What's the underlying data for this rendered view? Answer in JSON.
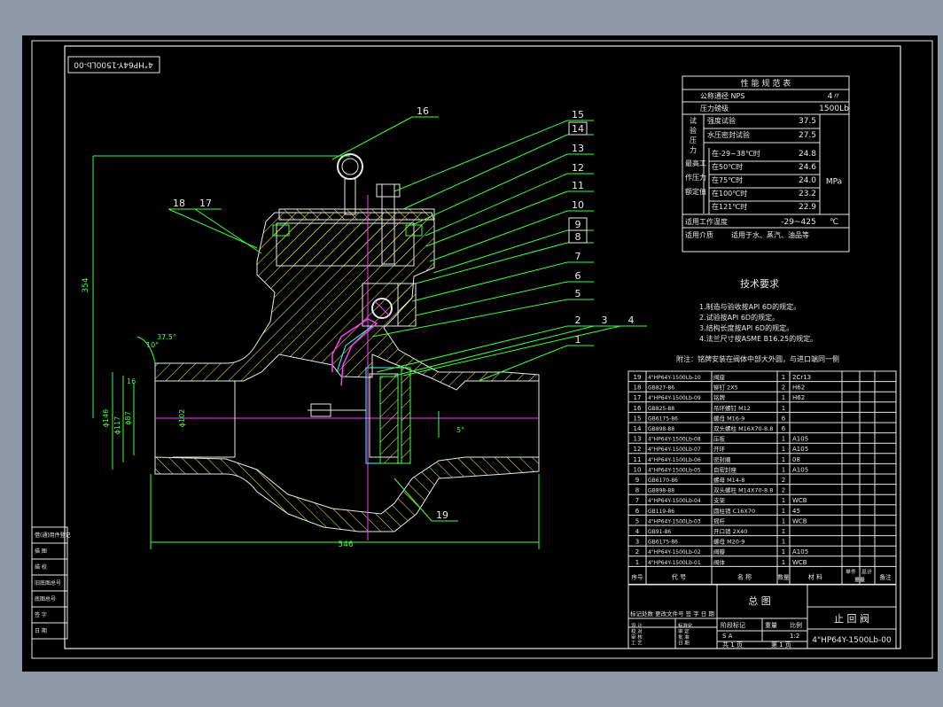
{
  "drawing_code_vertical": "4\"HP64Y-1500Lb-00",
  "part_numbers": [
    "16",
    "15",
    "14",
    "13",
    "12",
    "11",
    "10",
    "9",
    "8",
    "7",
    "6",
    "5",
    "2",
    "3",
    "4",
    "1",
    "18",
    "17",
    "19"
  ],
  "dimensions": {
    "overall_length": "546",
    "height": "354",
    "dia_146": "ϕ146",
    "dia_117": "ϕ117",
    "dia_87": "ϕ87",
    "dia_102": "ϕ102",
    "len_16": "16",
    "angle_10": "10°",
    "angle_37": "37.5°",
    "angle_5": "5°"
  },
  "perf_table": {
    "title": "性 能 规 范 表",
    "rows": [
      {
        "label": "公称通径    NPS",
        "value": "4〃"
      },
      {
        "label": "压力磅级",
        "value": "1500Lb"
      }
    ],
    "test_group": "试验压力",
    "test_rows": [
      {
        "label": "强度试验",
        "value": "37.5"
      },
      {
        "label": "水压密封试验",
        "value": "27.5"
      }
    ],
    "work_group_lines": [
      "最高工",
      "作压力",
      "额定值"
    ],
    "work_rows": [
      {
        "label": "在-29~38℃时",
        "value": "24.8"
      },
      {
        "label": "在50℃时",
        "value": "24.6"
      },
      {
        "label": "在75℃时",
        "value": "24.0"
      },
      {
        "label": "在100℃时",
        "value": "23.2"
      },
      {
        "label": "在121℃时",
        "value": "22.9"
      }
    ],
    "unit": "MPa",
    "temp_label": "适用工作温度",
    "temp_value": "-29~425",
    "temp_unit": "℃",
    "medium_label": "适用介质",
    "medium_value": "适用于水、蒸汽、油品等"
  },
  "tech_req": {
    "title": "技术要求",
    "items": [
      "1.制造与验收按API 6D的规定。",
      "2.试验按API 6D的规定。",
      "3.结构长度按API 6D的规定。",
      "4.法兰尺寸按ASME B16.25的规定。"
    ],
    "note": "附注：铭牌安装在阀体中部大外圆，与进口端同一侧"
  },
  "bom": [
    {
      "no": "19",
      "code": "4\"HP64Y-1500Lb-10",
      "name": "阀座",
      "qty": "1",
      "material": "2Cr13"
    },
    {
      "no": "18",
      "code": "GB827-86",
      "name": "铆钉 2X5",
      "qty": "2",
      "material": "H62"
    },
    {
      "no": "17",
      "code": "4\"HP64Y-1500Lb-09",
      "name": "铭牌",
      "qty": "1",
      "material": "H62"
    },
    {
      "no": "16",
      "code": "GB825-88",
      "name": "吊环螺钉 M12",
      "qty": "1",
      "material": ""
    },
    {
      "no": "15",
      "code": "GB6175-86",
      "name": "螺母 M16-9",
      "qty": "6",
      "material": ""
    },
    {
      "no": "14",
      "code": "GB898-88",
      "name": "双头螺柱 M16X70-8.8",
      "qty": "6",
      "material": ""
    },
    {
      "no": "13",
      "code": "4\"HP64Y-1500Lb-08",
      "name": "压板",
      "qty": "1",
      "material": "A105"
    },
    {
      "no": "12",
      "code": "4\"HP64Y-1500Lb-07",
      "name": "开环",
      "qty": "1",
      "material": "A105"
    },
    {
      "no": "11",
      "code": "4\"HP64Y-1500Lb-06",
      "name": "密封圈",
      "qty": "1",
      "material": "08"
    },
    {
      "no": "10",
      "code": "4\"HP64Y-1500Lb-05",
      "name": "自密封座",
      "qty": "1",
      "material": "A105"
    },
    {
      "no": "9",
      "code": "GB6170-86",
      "name": "螺母 M14-8",
      "qty": "2",
      "material": ""
    },
    {
      "no": "8",
      "code": "GB898-88",
      "name": "双头螺柱 M14X70-8.8",
      "qty": "2",
      "material": ""
    },
    {
      "no": "7",
      "code": "4\"HP64Y-1500Lb-04",
      "name": "支架",
      "qty": "1",
      "material": "WCB"
    },
    {
      "no": "6",
      "code": "GB119-86",
      "name": "圆柱销 C16X70",
      "qty": "1",
      "material": "45"
    },
    {
      "no": "5",
      "code": "4\"HP64Y-1500Lb-03",
      "name": "摇杆",
      "qty": "1",
      "material": "WCB"
    },
    {
      "no": "4",
      "code": "GB91-86",
      "name": "开口销 2X40",
      "qty": "1",
      "material": ""
    },
    {
      "no": "3",
      "code": "GB6175-86",
      "name": "螺母 M20-9",
      "qty": "1",
      "material": ""
    },
    {
      "no": "2",
      "code": "4\"HP64Y-1500Lb-02",
      "name": "阀瓣",
      "qty": "1",
      "material": "A105"
    },
    {
      "no": "1",
      "code": "4\"HP64Y-1500Lb-01",
      "name": "阀体",
      "qty": "1",
      "material": "WCB"
    }
  ],
  "bom_header": {
    "no": "序号",
    "code": "代    号",
    "name": "名    称",
    "qty": "数量",
    "material": "材  料",
    "unit_weight": "单件",
    "total_weight": "总计",
    "weight": "重量",
    "remark": "备注"
  },
  "title_block": {
    "title": "总  图",
    "name": "止 回 阀",
    "code": "4\"HP64Y-1500Lb-00",
    "scale": "1:2",
    "sheet_total": "共 1 页",
    "sheet_no": "第 1 页",
    "stage": "阶段标记",
    "weight": "重量",
    "ratio": "比例",
    "mark": "S  A",
    "rev_cols": "标记处数   更改文件号   签 字   日 期",
    "roles_left": [
      "设 计",
      "校 对",
      "审 核",
      "工 艺"
    ],
    "roles_right": [
      "标准化",
      "审 定",
      "批 准",
      "日 期"
    ]
  },
  "left_strip": [
    "借(通)用件登记",
    "描  图",
    "描  校",
    "旧底图总号",
    "底图总号",
    "签  字",
    "日  期"
  ]
}
